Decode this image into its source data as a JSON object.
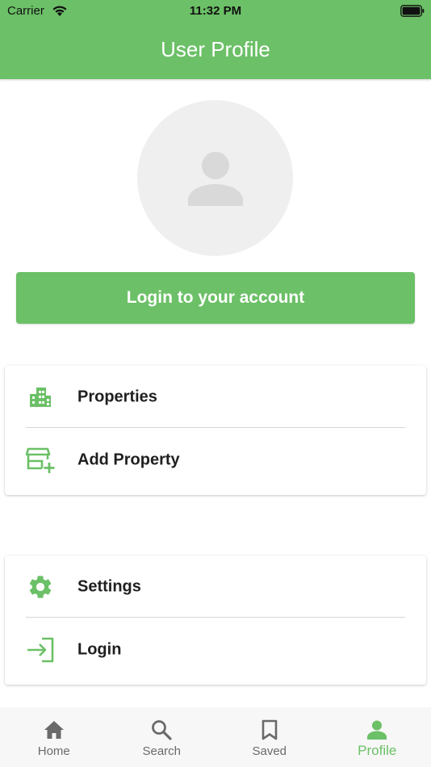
{
  "status_bar": {
    "carrier": "Carrier",
    "time": "11:32 PM"
  },
  "header": {
    "title": "User Profile"
  },
  "colors": {
    "primary": "#6cc067",
    "avatar_bg": "#efefef",
    "avatar_fg": "#d9d9d9",
    "nav_inactive": "#6a6a6a"
  },
  "login_button": {
    "label": "Login to your account"
  },
  "menu_group_1": [
    {
      "label": "Properties",
      "icon": "buildings-icon"
    },
    {
      "label": "Add Property",
      "icon": "add-store-icon"
    }
  ],
  "menu_group_2": [
    {
      "label": "Settings",
      "icon": "gear-icon"
    },
    {
      "label": "Login",
      "icon": "login-icon"
    }
  ],
  "bottom_nav": [
    {
      "label": "Home",
      "icon": "home-icon",
      "active": false
    },
    {
      "label": "Search",
      "icon": "search-icon",
      "active": false
    },
    {
      "label": "Saved",
      "icon": "bookmark-icon",
      "active": false
    },
    {
      "label": "Profile",
      "icon": "person-icon",
      "active": true
    }
  ]
}
